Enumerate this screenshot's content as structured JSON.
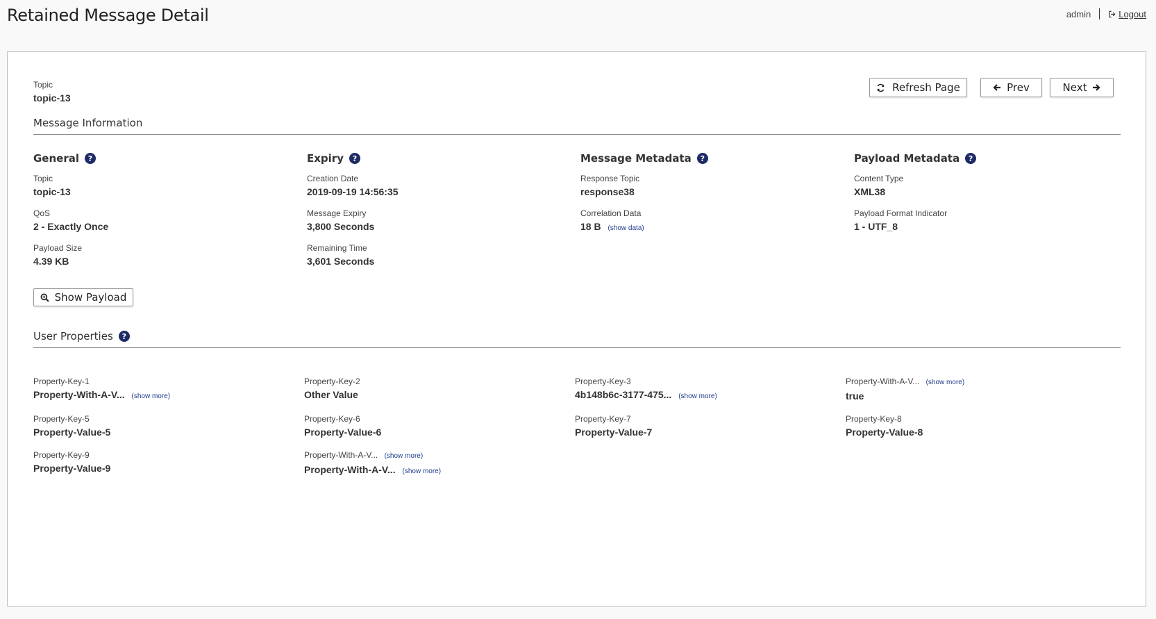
{
  "page": {
    "title": "Retained Message Detail"
  },
  "userbar": {
    "username": "admin",
    "logout_label": "Logout"
  },
  "header_topic": {
    "label": "Topic",
    "value": "topic-13"
  },
  "toolbar": {
    "refresh_label": "Refresh Page",
    "prev_label": "Prev",
    "next_label": "Next"
  },
  "message_info": {
    "title": "Message Information",
    "general": {
      "title": "General",
      "fields": [
        {
          "label": "Topic",
          "value": "topic-13"
        },
        {
          "label": "QoS",
          "value": "2 - Exactly Once"
        },
        {
          "label": "Payload Size",
          "value": "4.39 KB"
        }
      ]
    },
    "expiry": {
      "title": "Expiry",
      "fields": [
        {
          "label": "Creation Date",
          "value": "2019-09-19 14:56:35"
        },
        {
          "label": "Message Expiry",
          "value": "3,800 Seconds"
        },
        {
          "label": "Remaining Time",
          "value": "3,601 Seconds"
        }
      ]
    },
    "message_metadata": {
      "title": "Message Metadata",
      "fields": [
        {
          "label": "Response Topic",
          "value": "response38"
        },
        {
          "label": "Correlation Data",
          "value": "18 B",
          "link": "(show data)"
        }
      ]
    },
    "payload_metadata": {
      "title": "Payload Metadata",
      "fields": [
        {
          "label": "Content Type",
          "value": "XML38"
        },
        {
          "label": "Payload Format Indicator",
          "value": "1 - UTF_8"
        }
      ]
    },
    "show_payload_label": "Show Payload"
  },
  "user_properties": {
    "title": "User Properties",
    "show_more": "(show more)",
    "items": [
      {
        "key": "Property-Key-1",
        "value": "Property-With-A-V..."
      },
      {
        "key": "Property-Key-2",
        "value": "Other Value"
      },
      {
        "key": "Property-Key-3",
        "value": "4b148b6c-3177-475..."
      },
      {
        "key": "Property-With-A-V...",
        "value": "true"
      },
      {
        "key": "Property-Key-5",
        "value": "Property-Value-5"
      },
      {
        "key": "Property-Key-6",
        "value": "Property-Value-6"
      },
      {
        "key": "Property-Key-7",
        "value": "Property-Value-7"
      },
      {
        "key": "Property-Key-8",
        "value": "Property-Value-8"
      },
      {
        "key": "Property-Key-9",
        "value": "Property-Value-9"
      },
      {
        "key": "Property-With-A-V...",
        "value": "Property-With-A-V..."
      }
    ]
  },
  "icons": {
    "help": "question-circle-icon",
    "refresh": "refresh-icon",
    "prev": "arrow-left-icon",
    "next": "arrow-right-icon",
    "payload": "search-icon",
    "logout": "sign-out-icon"
  },
  "colors": {
    "help_badge": "#1d2b66",
    "link": "#1d3a8a"
  }
}
